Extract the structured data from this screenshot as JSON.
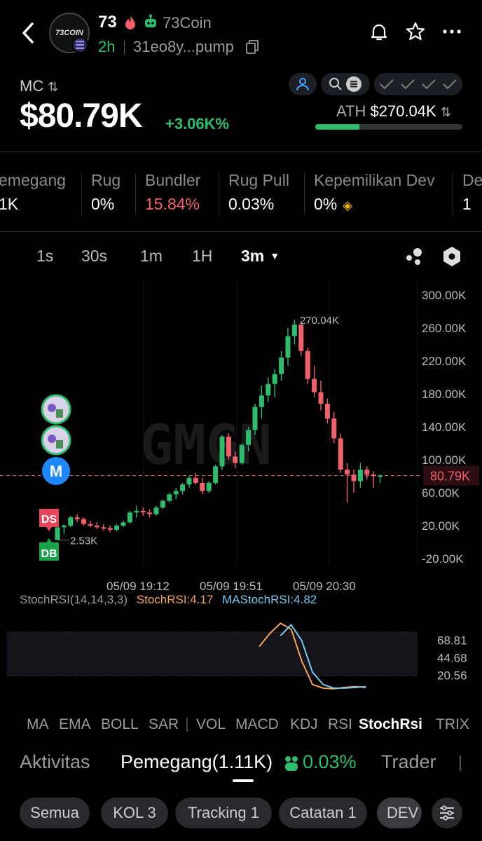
{
  "header": {
    "avatar_text": "73COIN",
    "symbol": "73",
    "name": "73Coin",
    "age": "2h",
    "address": "31eo8y...pump"
  },
  "market": {
    "label": "MC",
    "value": "$80.79K",
    "change": "+3.06K%",
    "ath_label": "ATH",
    "ath_value": "$270.04K",
    "ath_progress": 0.3
  },
  "stats": [
    {
      "label": "emegang",
      "value": "1K"
    },
    {
      "label": "Rug",
      "value": "0%"
    },
    {
      "label": "Bundler",
      "value": "15.84%"
    },
    {
      "label": "Rug Pull",
      "value": "0.03%"
    },
    {
      "label": "Kepemilikan Dev",
      "value": "0%"
    },
    {
      "label": "De",
      "value": "1"
    }
  ],
  "timeframes": [
    "1s",
    "30s",
    "1m",
    "1H",
    "3m"
  ],
  "active_timeframe": "3m",
  "chart_data": {
    "type": "candlestick",
    "y_ticks": [
      "300.00K",
      "260.00K",
      "220.00K",
      "180.00K",
      "140.00K",
      "100.00K",
      "60.00K",
      "20.00K",
      "-20.00K"
    ],
    "x_ticks": [
      "05/09 19:12",
      "05/09 19:51",
      "05/09 20:30"
    ],
    "current_price_label": "80.79K",
    "high_label": "270.04K",
    "low_label": "2.53K",
    "markers": [
      "M",
      "DS",
      "DB"
    ],
    "watermark": "GMGN",
    "candles": [
      [
        2.5,
        18,
        2.5,
        18
      ],
      [
        18,
        22,
        10,
        20
      ],
      [
        20,
        32,
        18,
        30
      ],
      [
        30,
        34,
        24,
        28
      ],
      [
        28,
        30,
        20,
        22
      ],
      [
        22,
        26,
        18,
        20
      ],
      [
        20,
        24,
        16,
        18
      ],
      [
        18,
        22,
        14,
        17
      ],
      [
        17,
        20,
        12,
        15
      ],
      [
        15,
        22,
        13,
        20
      ],
      [
        20,
        26,
        18,
        24
      ],
      [
        24,
        38,
        22,
        36
      ],
      [
        36,
        44,
        30,
        38
      ],
      [
        38,
        42,
        32,
        36
      ],
      [
        36,
        40,
        30,
        34
      ],
      [
        34,
        44,
        32,
        42
      ],
      [
        42,
        52,
        40,
        50
      ],
      [
        50,
        60,
        48,
        58
      ],
      [
        58,
        66,
        52,
        62
      ],
      [
        62,
        72,
        58,
        70
      ],
      [
        70,
        80,
        66,
        78
      ],
      [
        78,
        84,
        70,
        72
      ],
      [
        72,
        78,
        58,
        62
      ],
      [
        62,
        74,
        60,
        72
      ],
      [
        72,
        94,
        70,
        92
      ],
      [
        92,
        130,
        88,
        128
      ],
      [
        128,
        132,
        100,
        104
      ],
      [
        104,
        110,
        90,
        96
      ],
      [
        96,
        120,
        94,
        118
      ],
      [
        118,
        140,
        110,
        136
      ],
      [
        136,
        168,
        130,
        164
      ],
      [
        164,
        190,
        150,
        178
      ],
      [
        178,
        200,
        170,
        192
      ],
      [
        192,
        210,
        176,
        204
      ],
      [
        204,
        232,
        196,
        224
      ],
      [
        224,
        260,
        214,
        250
      ],
      [
        250,
        270,
        240,
        264
      ],
      [
        264,
        268,
        226,
        232
      ],
      [
        232,
        236,
        192,
        198
      ],
      [
        198,
        214,
        176,
        182
      ],
      [
        182,
        196,
        160,
        168
      ],
      [
        168,
        174,
        144,
        150
      ],
      [
        150,
        158,
        120,
        126
      ],
      [
        126,
        132,
        84,
        88
      ],
      [
        88,
        96,
        48,
        82
      ],
      [
        82,
        88,
        60,
        74
      ],
      [
        74,
        96,
        66,
        88
      ],
      [
        88,
        92,
        76,
        82
      ],
      [
        82,
        86,
        66,
        80
      ],
      [
        80,
        82,
        72,
        81
      ]
    ]
  },
  "stochrsi": {
    "params": "StochRSI(14,14,3,3)",
    "k_label": "StochRSI:4.17",
    "d_label": "MAStochRSI:4.82",
    "levels": [
      "68.81",
      "44.68",
      "20.56"
    ],
    "k_series": [
      60,
      78,
      92,
      84,
      40,
      8,
      3,
      2,
      4,
      5,
      4
    ],
    "d_series": [
      null,
      null,
      75,
      90,
      68,
      25,
      8,
      3,
      3,
      4,
      5
    ],
    "colors": {
      "k": "#f5a35a",
      "d": "#78c9ef"
    }
  },
  "indicator_tabs": [
    "MA",
    "EMA",
    "BOLL",
    "SAR",
    "VOL",
    "MACD",
    "KDJ",
    "RSI",
    "StochRsi",
    "TRIX"
  ],
  "active_indicator": "StochRsi",
  "section_tabs": {
    "activity": "Aktivitas",
    "holders": "Pemegang(1.11K)",
    "holders_pct": "0.03%",
    "traders": "Trader"
  },
  "filter_chips": [
    "Semua",
    "KOL 3",
    "Tracking 1",
    "Catatan 1",
    "DEV"
  ],
  "colors": {
    "up": "#2ebd6f",
    "down": "#f0616d",
    "background": "#000000"
  }
}
